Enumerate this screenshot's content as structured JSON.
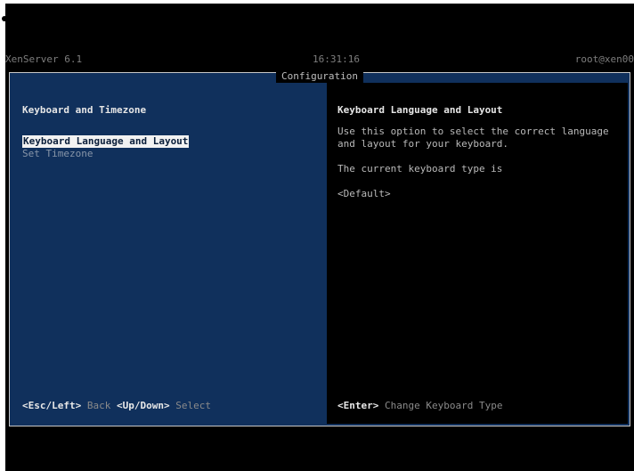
{
  "header": {
    "host_version": "XenServer 6.1",
    "clock": "16:31:16",
    "user": "root@xen00"
  },
  "frame": {
    "title": "Configuration"
  },
  "left_pane": {
    "heading": "Keyboard and Timezone",
    "menu": [
      {
        "label": "Keyboard Language and Layout",
        "selected": true
      },
      {
        "label": "Set Timezone",
        "selected": false
      }
    ],
    "hints": [
      {
        "key": "<Esc/Left>",
        "action": "Back"
      },
      {
        "key": "<Up/Down>",
        "action": "Select"
      }
    ]
  },
  "right_pane": {
    "title": "Keyboard Language and Layout",
    "description": [
      "Use this option to select the correct language and layout for your keyboard.",
      "The current keyboard type is",
      "<Default>"
    ],
    "hint": {
      "key": "<Enter>",
      "action": "Change Keyboard Type"
    }
  },
  "colors": {
    "left_pane_bg": "#10305c",
    "right_pane_bg": "#000000",
    "selection_bg": "#f2f2f2"
  }
}
